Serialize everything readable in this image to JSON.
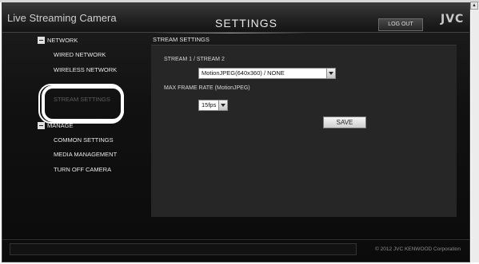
{
  "header": {
    "app_title": "Live Streaming Camera",
    "page_heading": "SETTINGS",
    "logout_label": "LOG OUT",
    "brand": "JVC"
  },
  "sidebar": {
    "network_label": "NETWORK",
    "network_items": [
      {
        "label": "WIRED NETWORK"
      },
      {
        "label": "WIRELESS NETWORK"
      },
      {
        "label": "STREAM SETTINGS",
        "active": true
      }
    ],
    "manage_label": "MANAGE",
    "manage_items": [
      {
        "label": "COMMON SETTINGS"
      },
      {
        "label": "MEDIA MANAGEMENT"
      },
      {
        "label": "TURN OFF CAMERA"
      }
    ]
  },
  "main": {
    "section_title": "STREAM SETTINGS",
    "stream_label": "STREAM 1 / STREAM 2",
    "stream_value": "MotionJPEG(640x360) / NONE",
    "frame_rate_label": "MAX FRAME RATE (MotionJPEG)",
    "frame_rate_value": "15fps",
    "save_label": "SAVE"
  },
  "footer": {
    "copyright": "© 2012 JVC KENWOOD Corporation"
  },
  "colors": {
    "background": "#111111",
    "panel": "#262626",
    "text": "#e8e8e8",
    "active_item": "#5e5e5e",
    "highlight_ring": "#ffffff"
  }
}
